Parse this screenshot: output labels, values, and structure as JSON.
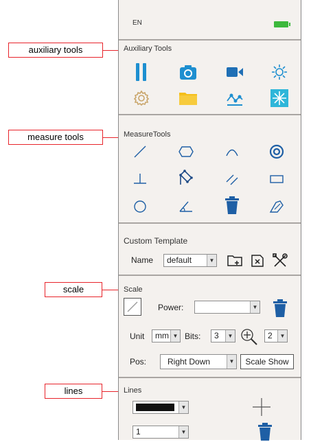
{
  "callouts": {
    "auxiliary": "auxiliary tools",
    "measure": "measure tools",
    "scale": "scale",
    "lines": "lines"
  },
  "header": {
    "language": "EN",
    "battery_color": "#3cb83c"
  },
  "auxiliary": {
    "title": "Auxiliary Tools",
    "icons": [
      "pause-icon",
      "camera-icon",
      "video-camera-icon",
      "brightness-icon",
      "settings-icon",
      "folder-icon",
      "curve-icon",
      "snowflake-icon"
    ]
  },
  "measure": {
    "title": "MeasureTools",
    "icons": [
      "line-icon",
      "polygon-icon",
      "arc-icon",
      "circle-at-icon",
      "perpendicular-icon",
      "rotated-rectangle-icon",
      "parallel-icon",
      "rectangle-icon",
      "circle-icon",
      "angle-icon",
      "delete-icon",
      "freehand-polygon-icon"
    ]
  },
  "template": {
    "title": "Custom Template",
    "name_label": "Name",
    "name_value": "default"
  },
  "scale": {
    "title": "Scale",
    "power_label": "Power:",
    "power_value": "",
    "unit_label": "Unit",
    "unit_value": "mm",
    "bits_label": "Bits:",
    "bits_value": "3",
    "zoom_value": "2",
    "pos_label": "Pos:",
    "pos_value": "Right Down",
    "scale_show_label": "Scale Show"
  },
  "lines": {
    "title": "Lines",
    "color_value": "#111111",
    "width_value": "1"
  },
  "colors": {
    "blue": "#1e8fd0",
    "dark_blue": "#1f6fb5",
    "callout_red": "#e8232a",
    "folder_yellow": "#f5bf1a"
  }
}
